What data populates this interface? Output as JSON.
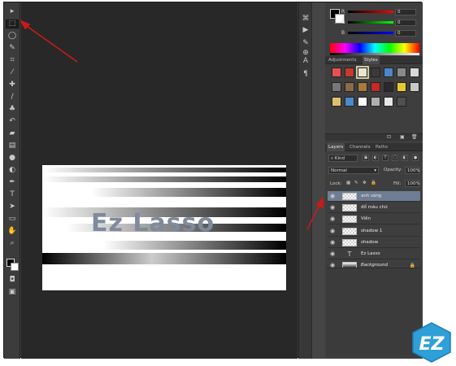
{
  "watermark": {
    "text": "EZ",
    "color": "#2f9fd8"
  },
  "tools": [
    {
      "name": "move-tool-icon",
      "glyph": "▸"
    },
    {
      "name": "rectangular-marquee-tool-icon",
      "glyph": "⬚",
      "active": true
    },
    {
      "name": "lasso-tool-icon",
      "glyph": "◯"
    },
    {
      "name": "quick-selection-tool-icon",
      "glyph": "✎"
    },
    {
      "name": "crop-tool-icon",
      "glyph": "⌗"
    },
    {
      "name": "eyedropper-tool-icon",
      "glyph": "⁄"
    },
    {
      "name": "healing-brush-tool-icon",
      "glyph": "✚"
    },
    {
      "name": "brush-tool-icon",
      "glyph": "/"
    },
    {
      "name": "clone-stamp-tool-icon",
      "glyph": "♣"
    },
    {
      "name": "history-brush-tool-icon",
      "glyph": "↶"
    },
    {
      "name": "eraser-tool-icon",
      "glyph": "▰"
    },
    {
      "name": "gradient-tool-icon",
      "glyph": "▤"
    },
    {
      "name": "blur-tool-icon",
      "glyph": "●"
    },
    {
      "name": "dodge-tool-icon",
      "glyph": "◐"
    },
    {
      "name": "pen-tool-icon",
      "glyph": "✒"
    },
    {
      "name": "type-tool-icon",
      "glyph": "T"
    },
    {
      "name": "path-selection-tool-icon",
      "glyph": "➤"
    },
    {
      "name": "rectangle-tool-icon",
      "glyph": "▭"
    },
    {
      "name": "hand-tool-icon",
      "glyph": "✋"
    },
    {
      "name": "zoom-tool-icon",
      "glyph": "⌕"
    }
  ],
  "quick_mask_icons": [
    {
      "name": "quick-mask-icon",
      "glyph": "◘"
    },
    {
      "name": "screen-mode-icon",
      "glyph": "▣"
    }
  ],
  "canvas": {
    "text": "Ez Lasso"
  },
  "mid_icons": [
    {
      "name": "history-panel-icon",
      "glyph": "⌘"
    },
    {
      "name": "actions-panel-icon",
      "glyph": "▶"
    },
    {
      "name": "brush-panel-icon",
      "glyph": "✎"
    },
    {
      "name": "clone-source-panel-icon",
      "glyph": "⊕"
    },
    {
      "name": "character-panel-icon",
      "glyph": "A"
    },
    {
      "name": "paragraph-panel-icon",
      "glyph": "¶"
    }
  ],
  "color_panel": {
    "sliders": [
      {
        "label": "R",
        "value": "0",
        "from": "#000000",
        "to": "#ff0000"
      },
      {
        "label": "G",
        "value": "0",
        "from": "#000000",
        "to": "#00ff00"
      },
      {
        "label": "B",
        "value": "0",
        "from": "#000000",
        "to": "#0000ff"
      }
    ]
  },
  "adjustments_tabs": [
    "Adjustments",
    "Styles"
  ],
  "styles_swatches": [
    "#e85050",
    "#c83a2a",
    "#e8e8d0",
    "#3a3a3a",
    "#4a86c8",
    "#8a8a8a",
    "#d8d8d8",
    "#777777",
    "#8a6a4a",
    "#a87a3a",
    "#c82828",
    "#2a2a2a",
    "#e8c830",
    "#c8c8c8",
    "#e0c070",
    "#4a8ad0",
    "#ffffff",
    "#b0b0b0",
    "#e8e8e8",
    "#505050"
  ],
  "layers_panel": {
    "tabs": [
      "Layers",
      "Channels",
      "Paths"
    ],
    "kind_label": "Kind",
    "blend_mode": "Normal",
    "opacity_label": "Opacity:",
    "opacity_value": "100%",
    "lock_label": "Lock:",
    "fill_label": "Fill:",
    "fill_value": "100%",
    "layers": [
      {
        "name": "anh sáng",
        "type": "raster",
        "selected": true
      },
      {
        "name": "đổ màu chữ",
        "type": "raster"
      },
      {
        "name": "Viền",
        "type": "raster"
      },
      {
        "name": "shadow 1",
        "type": "raster"
      },
      {
        "name": "shadow",
        "type": "raster"
      },
      {
        "name": "Ez Lasso",
        "type": "text"
      },
      {
        "name": "Background",
        "type": "background",
        "locked": true
      }
    ]
  }
}
